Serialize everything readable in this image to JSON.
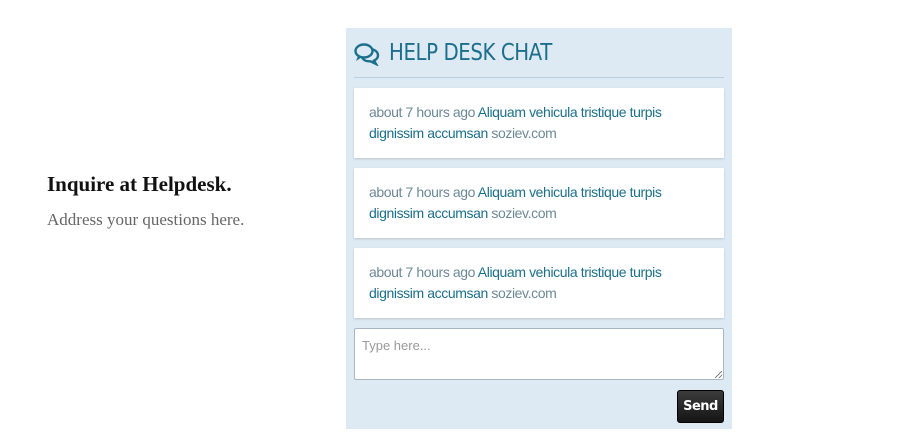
{
  "intro": {
    "title": "Inquire at Helpdesk.",
    "subtitle": "Address your questions here."
  },
  "chat": {
    "icon": "chat-bubbles-icon",
    "title": "HELP DESK CHAT",
    "accent_color": "#1b6f8c",
    "background_color": "#dde9f3",
    "messages": [
      {
        "time": "about 7 hours ago",
        "text": "Aliquam vehicula tristique turpis dignissim accumsan",
        "source": "soziev.com"
      },
      {
        "time": "about 7 hours ago",
        "text": "Aliquam vehicula tristique turpis dignissim accumsan",
        "source": "soziev.com"
      },
      {
        "time": "about 7 hours ago",
        "text": "Aliquam vehicula tristique turpis dignissim accumsan",
        "source": "soziev.com"
      }
    ],
    "input_placeholder": "Type here...",
    "send_label": "Send"
  }
}
